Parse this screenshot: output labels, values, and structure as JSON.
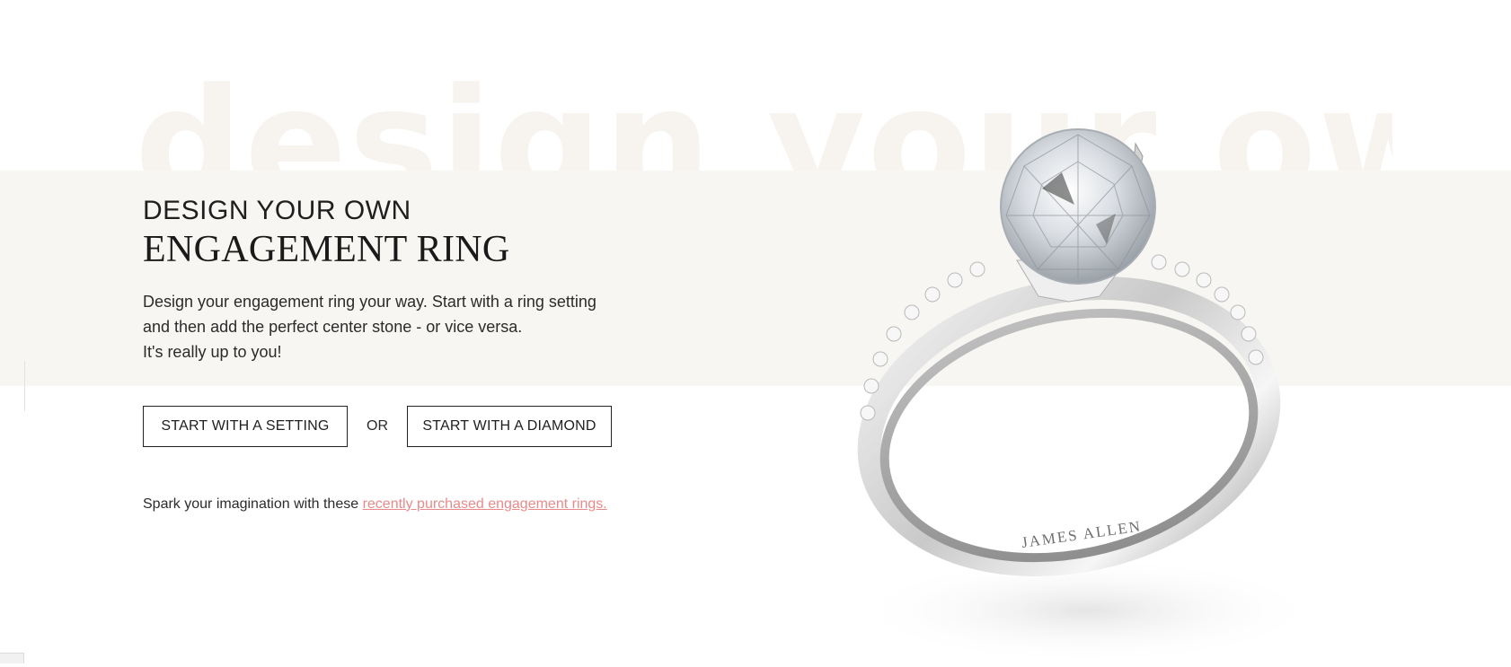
{
  "hero": {
    "watermark": "design your own",
    "kicker": "DESIGN YOUR OWN",
    "headline": "ENGAGEMENT RING",
    "description_lines": [
      "Design your engagement ring your way. Start with a ring setting",
      "and then add the perfect center stone - or vice versa.",
      "It's really up to you!"
    ]
  },
  "cta": {
    "setting_label": "START WITH A SETTING",
    "or_label": "OR",
    "diamond_label": "START WITH A DIAMOND"
  },
  "spark": {
    "prefix": "Spark your imagination with these ",
    "link_text": "recently purchased engagement rings."
  },
  "image": {
    "engraving": "JAMES ALLEN"
  },
  "colors": {
    "band_bg": "#f8f6f2",
    "link": "#e98a8a",
    "text": "#2b2b2b"
  }
}
